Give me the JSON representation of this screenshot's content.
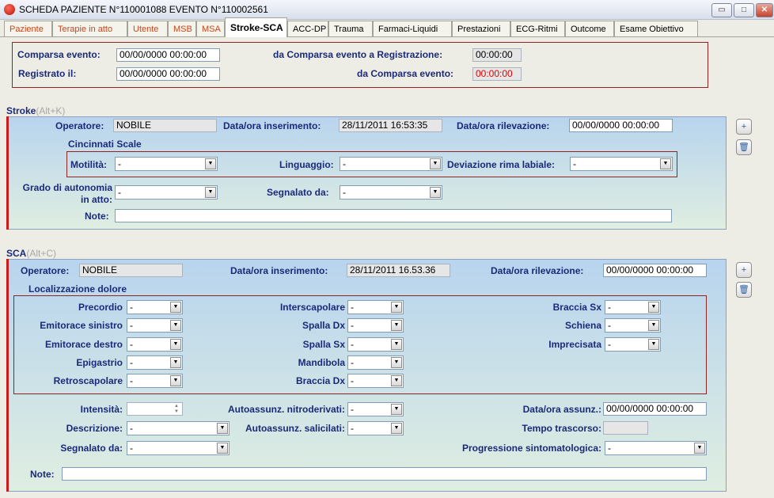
{
  "window": {
    "title": "SCHEDA PAZIENTE N°110001088  EVENTO N°110002561",
    "min_glyph": "▭",
    "max_glyph": "□",
    "close_glyph": "✕"
  },
  "tabs": [
    {
      "label": "Paziente"
    },
    {
      "label": "Terapie in atto"
    },
    {
      "label": "Utente"
    },
    {
      "label": "MSB"
    },
    {
      "label": "MSA"
    },
    {
      "label": "Stroke-SCA"
    },
    {
      "label": "ACC-DP"
    },
    {
      "label": "Trauma"
    },
    {
      "label": "Farmaci-Liquidi"
    },
    {
      "label": "Prestazioni"
    },
    {
      "label": "ECG-Ritmi"
    },
    {
      "label": "Outcome"
    },
    {
      "label": "Esame Obiettivo"
    }
  ],
  "header": {
    "comparsa_label": "Comparsa evento:",
    "comparsa_value": "00/00/0000 00:00:00",
    "registrato_label": "Registrato il:",
    "registrato_value": "00/00/0000 00:00:00",
    "da_comparsa_reg_label": "da Comparsa evento a Registrazione:",
    "da_comparsa_reg_value": "00:00:00",
    "da_comparsa_label": "da Comparsa evento:",
    "da_comparsa_value": "00:00:00"
  },
  "stroke": {
    "title": "Stroke",
    "shortcut": "(Alt+K)",
    "operatore_label": "Operatore:",
    "operatore_value": "NOBILE",
    "ins_label": "Data/ora inserimento:",
    "ins_value": "28/11/2011 16:53:35",
    "ril_label": "Data/ora rilevazione:",
    "ril_value": "00/00/0000 00:00:00",
    "cincinnati_label": "Cincinnati Scale",
    "motilita_label": "Motilità:",
    "motilita_value": "-",
    "linguaggio_label": "Linguaggio:",
    "linguaggio_value": "-",
    "deviazione_label": "Deviazione rima labiale:",
    "deviazione_value": "-",
    "grado_label_1": "Grado di autonomia",
    "grado_label_2": "in atto:",
    "grado_value": "-",
    "segnalato_label": "Segnalato da:",
    "segnalato_value": "-",
    "note_label": "Note:",
    "note_value": ""
  },
  "sca": {
    "title": "SCA",
    "shortcut": "(Alt+C)",
    "operatore_label": "Operatore:",
    "operatore_value": "NOBILE",
    "ins_label": "Data/ora inserimento:",
    "ins_value": "28/11/2011 16.53.36",
    "ril_label": "Data/ora rilevazione:",
    "ril_value": "00/00/0000 00:00:00",
    "loc_label": "Localizzazione dolore",
    "locs": [
      {
        "label": "Precordio",
        "value": "-"
      },
      {
        "label": "Emitorace sinistro",
        "value": "-"
      },
      {
        "label": "Emitorace destro",
        "value": "-"
      },
      {
        "label": "Epigastrio",
        "value": "-"
      },
      {
        "label": "Retroscapolare",
        "value": "-"
      },
      {
        "label": "Interscapolare",
        "value": "-"
      },
      {
        "label": "Spalla Dx",
        "value": "-"
      },
      {
        "label": "Spalla Sx",
        "value": "-"
      },
      {
        "label": "Mandibola",
        "value": "-"
      },
      {
        "label": "Braccia Dx",
        "value": "-"
      },
      {
        "label": "Braccia Sx",
        "value": "-"
      },
      {
        "label": "Schiena",
        "value": "-"
      },
      {
        "label": "Imprecisata",
        "value": "-"
      }
    ],
    "intensita_label": "Intensità:",
    "intensita_value": "",
    "nitro_label": "Autoassunz. nitroderivati:",
    "nitro_value": "-",
    "assunz_label": "Data/ora assunz.:",
    "assunz_value": "00/00/0000 00:00:00",
    "descrizione_label": "Descrizione:",
    "descrizione_value": "-",
    "salicilati_label": "Autoassunz. salicilati:",
    "salicilati_value": "-",
    "tempo_label": "Tempo trascorso:",
    "tempo_value": "",
    "segnalato_label": "Segnalato da:",
    "segnalato_value": "-",
    "progressione_label": "Progressione sintomatologica:",
    "progressione_value": "-",
    "note_label": "Note:",
    "note_value": ""
  }
}
